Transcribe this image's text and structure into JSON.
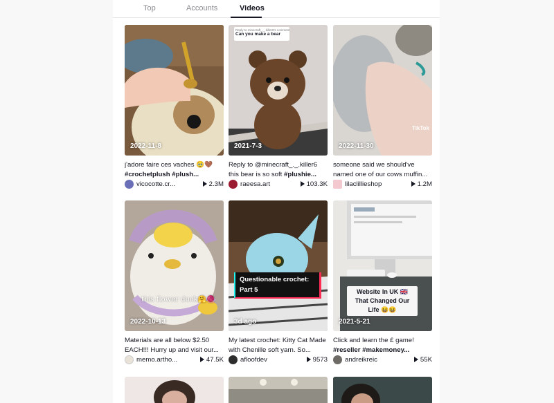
{
  "tabs": [
    {
      "label": "Top",
      "active": false
    },
    {
      "label": "Accounts",
      "active": false
    },
    {
      "label": "Videos",
      "active": true
    }
  ],
  "videos": [
    {
      "date": "2022-11-8",
      "caption_text": "j'adore faire ces vaches 🥹🤎",
      "caption_tags": "#crochetplush #plush...",
      "author": "vicocotte.cr...",
      "views": "2.3M"
    },
    {
      "date": "2021-7-3",
      "caption_text": "Reply to @minecraft_._.killer6 this bear is so soft",
      "caption_tags": "#plushie...",
      "author": "raeesa.art",
      "views": "103.3K",
      "overlay_small": "Reply to minecraft_._.killer6's comment",
      "overlay_question": "Can you make a bear"
    },
    {
      "date": "2022-11-30",
      "caption_text": "someone said we should've named one of our cows muffin...",
      "caption_tags": "",
      "author": "lilaclillieshop",
      "views": "1.2M",
      "watermark": "TikTok"
    },
    {
      "date": "2022-10-13",
      "caption_text": "Materials are all below $2.50 EACH!!! Hurry up and visit our...",
      "caption_tags": "",
      "author": "memo.artho...",
      "views": "47.5K",
      "overlay_text": "this flower duck🤗🧶"
    },
    {
      "date": "3d ago",
      "caption_text": "My latest crochet: Kitty Cat Made with Chenille soft yarn. So...",
      "caption_tags": "",
      "author": "afloofdev",
      "views": "9573",
      "overlay_title": "Questionable crochet: Part 5"
    },
    {
      "date": "2021-5-21",
      "caption_text": "Click and learn the £ game!",
      "caption_tags": "#reseller #makemoney...",
      "author": "andreikreic",
      "views": "55K",
      "overlay_title": "Website In UK 🇬🇧 That Changed Our Life 😆😆"
    }
  ],
  "colors": {
    "text_primary": "#161823",
    "text_secondary": "#8a8b91",
    "accent_red": "#fe2c55",
    "accent_cyan": "#25f4ee"
  }
}
